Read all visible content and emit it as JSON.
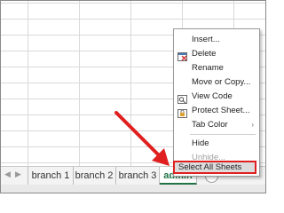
{
  "tabs": [
    "branch 1",
    "branch 2",
    "branch 3",
    "admin"
  ],
  "nav": {
    "left": "◀",
    "right": "▶"
  },
  "add_sheet": "+",
  "menu": {
    "items": [
      {
        "label": "Insert...",
        "icon": ""
      },
      {
        "label": "Delete",
        "icon": "delete-sheet-icon"
      },
      {
        "label": "Rename",
        "icon": ""
      },
      {
        "label": "Move or Copy...",
        "icon": ""
      },
      {
        "label": "View Code",
        "icon": "view-code-icon"
      },
      {
        "label": "Protect Sheet...",
        "icon": "protect-sheet-icon"
      },
      {
        "label": "Tab Color",
        "icon": "",
        "submenu": "›"
      },
      {
        "label": "Hide",
        "icon": ""
      },
      {
        "label": "Unhide...",
        "icon": "",
        "disabled": true
      },
      {
        "label": "Select All Sheets",
        "icon": ""
      }
    ]
  },
  "colors": {
    "accent": "#217346",
    "callout": "#e02020"
  }
}
